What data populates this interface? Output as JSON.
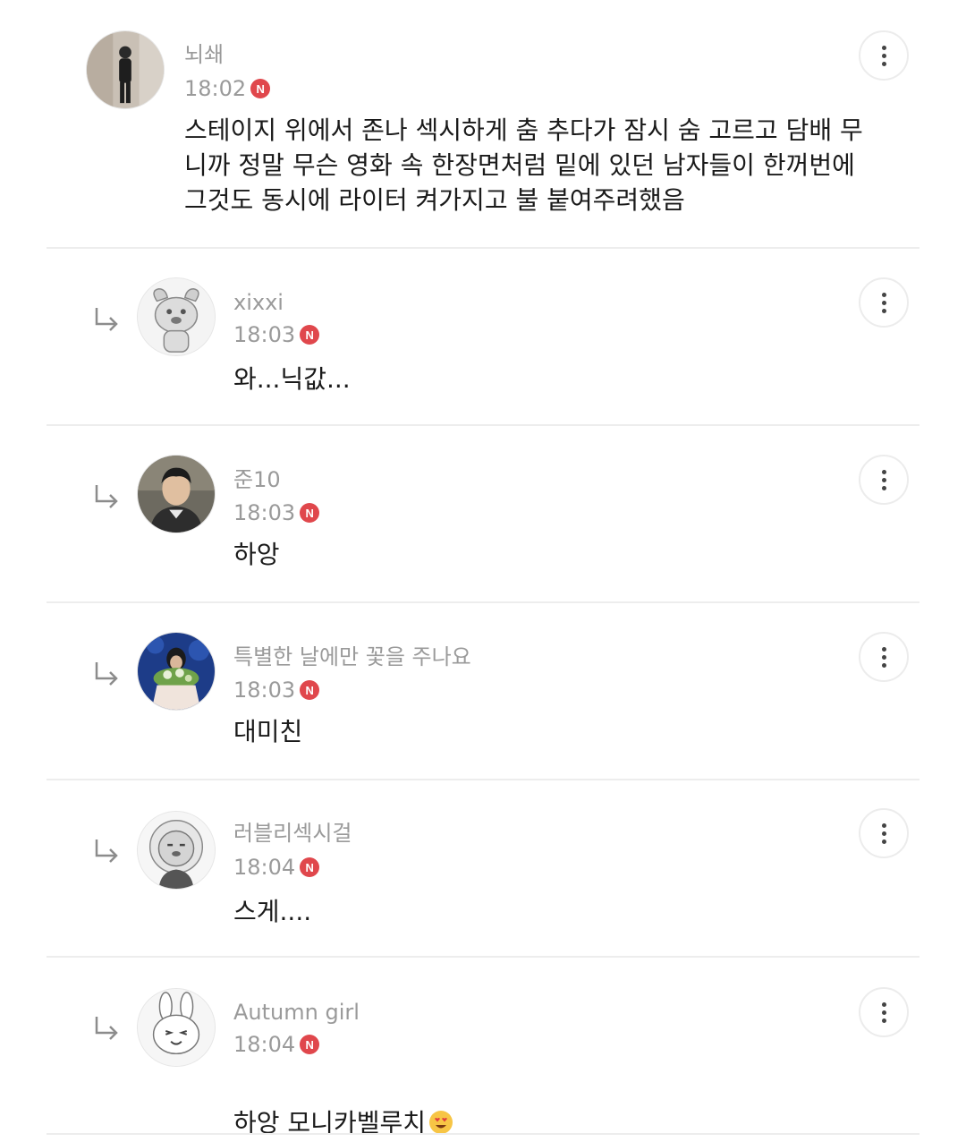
{
  "comments": [
    {
      "author": "뇌쇄",
      "time": "18:02",
      "badge": "N",
      "text": "스테이지 위에서 존나 섹시하게 춤 추다가 잠시 숨 고르고 담배 무\n니까 정말 무슨 영화 속 한장면처럼 밑에 있던 남자들이 한꺼번에\n그것도 동시에 라이터 켜가지고 불 붙여주려했음",
      "avatar_icon": "person-photo-avatar",
      "is_reply": false
    },
    {
      "author": "xixxi",
      "time": "18:03",
      "badge": "N",
      "text": "와...닉값...",
      "avatar_icon": "cartoon-dog-avatar",
      "is_reply": true
    },
    {
      "author": "준10",
      "time": "18:03",
      "badge": "N",
      "text": "하앙",
      "avatar_icon": "person-photo-avatar",
      "is_reply": true
    },
    {
      "author": "특별한 날에만 꽃을 주나요",
      "time": "18:03",
      "badge": "N",
      "text": "대미친",
      "avatar_icon": "flowers-photo-avatar",
      "is_reply": true
    },
    {
      "author": "러블리섹시걸",
      "time": "18:04",
      "badge": "N",
      "text": "스게....",
      "avatar_icon": "cartoon-lion-avatar",
      "is_reply": true
    },
    {
      "author": "Autumn girl",
      "time": "18:04",
      "badge": "N",
      "text": "하앙 모니카벨루치",
      "text_emoji": "smiling-face-with-heart-eyes",
      "avatar_icon": "cartoon-rabbit-avatar",
      "is_reply": true
    }
  ],
  "colors": {
    "meta_text": "#9a9a9a",
    "body_text": "#1a1a1a",
    "new_badge": "#e0474c",
    "divider": "#ededed"
  }
}
